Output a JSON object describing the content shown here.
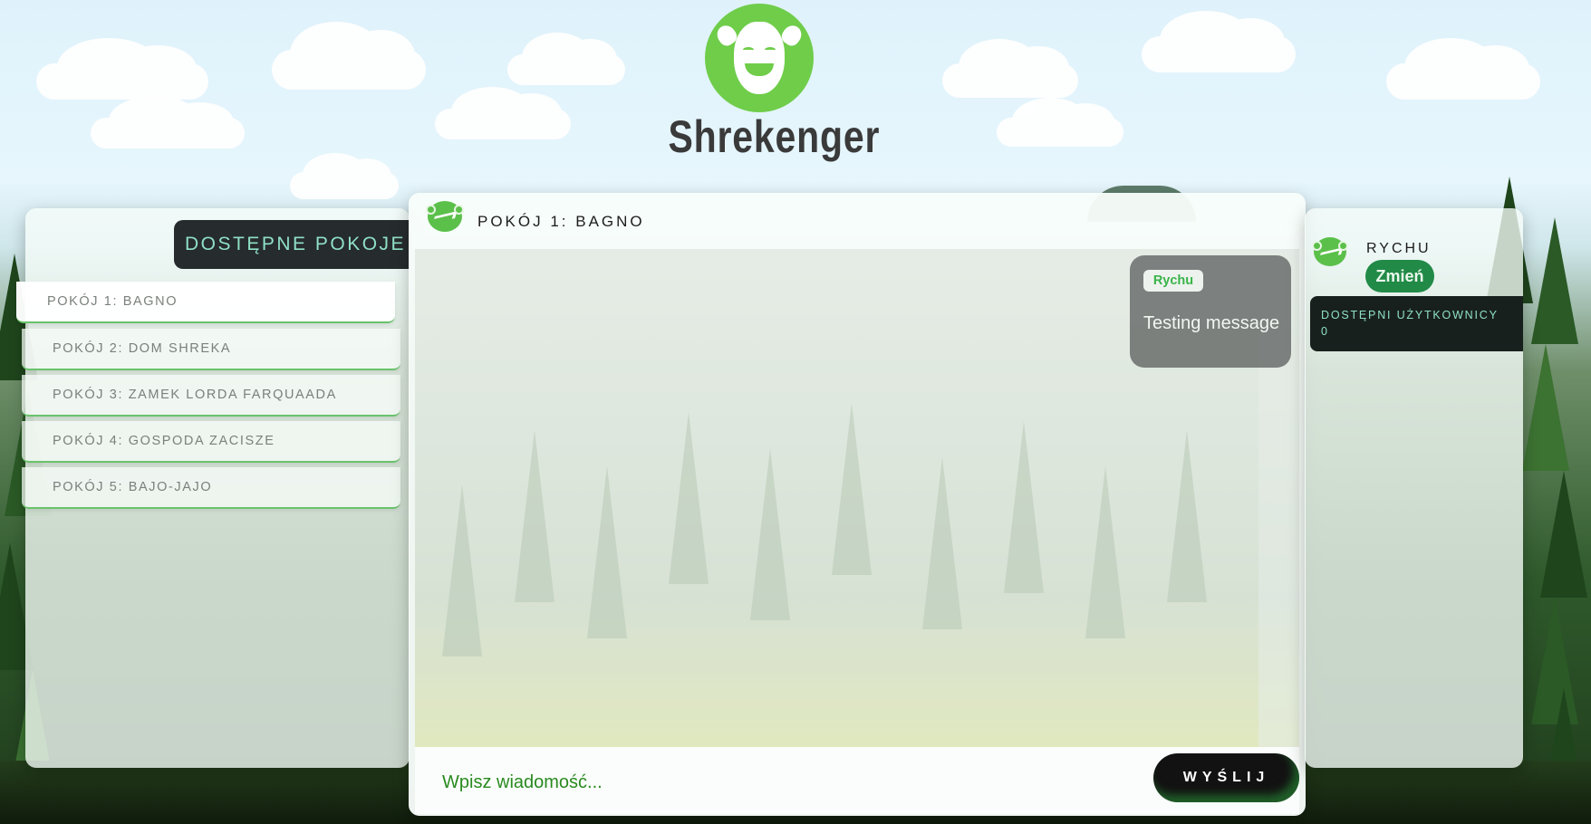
{
  "app": {
    "logo_text": "Shrekenger"
  },
  "rooms": {
    "title": "DOSTĘPNE POKOJE",
    "items": [
      {
        "label": "POKÓJ 1: BAGNO",
        "active": true
      },
      {
        "label": "POKÓJ 2: DOM SHREKA",
        "active": false
      },
      {
        "label": "POKÓJ 3: ZAMEK LORDA FARQUAADA",
        "active": false
      },
      {
        "label": "POKÓJ 4: GOSPODA ZACISZE",
        "active": false
      },
      {
        "label": "POKÓJ 5: BAJO-JAJO",
        "active": false
      }
    ]
  },
  "chat": {
    "room_title": "POKÓJ 1: BAGNO",
    "messages": [
      {
        "author": "Rychu",
        "text": "Testing message"
      }
    ],
    "input_placeholder": "Wpisz wiadomość...",
    "send_label": "WYŚLIJ"
  },
  "user": {
    "name": "RYCHU",
    "change_label": "Zmień"
  },
  "users_box": {
    "label": "DOSTĘPNI UŻYTKOWNICY",
    "count": "0"
  },
  "colors": {
    "accent_green": "#218a47",
    "logo_green": "#6fcd4a",
    "dark": "#262b2d",
    "teal_text": "#8fe0c6"
  }
}
